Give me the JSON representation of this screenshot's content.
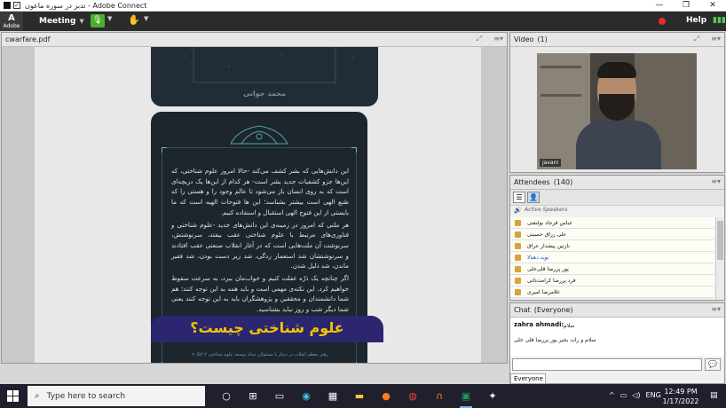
{
  "window": {
    "title": "تدبر در سوره ماعون - Adobe Connect",
    "controls": [
      "—",
      "❐",
      "✕"
    ]
  },
  "menubar": {
    "adobe_label": "Adobe",
    "meeting": "Meeting",
    "help": "Help"
  },
  "share": {
    "title": "cwarfare.pdf",
    "card_top_name": "محمد جواتی",
    "paragraphs": [
      "این دانش‌هایی که بشر کشف می‌کند -حالا امروز علوم شناختی، که این‌ها جزو کشفیات جدید بشر است- هر کدام از این‌ها یک دریچه‌ای است که به روی انسان باز می‌شود تا عالم وجود را و هستی را که صُنع الهی است بیشتر بشناسد؛ این ها فتوحات الهیه است که ما بایستی از این فتوح الهی استقبال و استفاده کنیم.",
      "هر ملتی که امروز در زمینه‌ی این دانش‌های جدید -علوم شناختی و فناوری‌های مرتبط با علوم شناختی عقب بیفتد، سرنوشتش، سرنوشت آن ملت‌هایی است که در آغاز انقلاب صنعتی عقب افتادند و سرنوشتشان شد استعمار زدگی، شد زیر دست بودن، شد فقیر ماندن، شد ذلیل شدن.",
      "اگر چنانچه یک ذرّه غفلت کنیم و خواب‌مان ببرد، به سرعت سقوط خواهیم کرد. این نکته‌ی مهمی است و باید همه به این توجه کنند؛ هم شما دانشمندان و محققین و پژوهشگران باید به این توجه کنند یعنی شما دیگر شب و روز نباید بشناسید."
    ],
    "footer": "رهبر معظم انقلاب در دیدار با مسئولان ستاد توسعه علوم شناختی ۹۰/۵/۱۲",
    "banner": "علوم شناختی چیست؟"
  },
  "video": {
    "title": "Video",
    "count": "(1)",
    "participant": "javani"
  },
  "attendees": {
    "title": "Attendees",
    "count": "(140)",
    "section": "Active Speakers",
    "rows": [
      {
        "name": "عباس فرجاد بولنفتی",
        "hl": false
      },
      {
        "name": "علی رزاق حسینی",
        "hl": false
      },
      {
        "name": "نازنین پیشدار عراق",
        "hl": false
      },
      {
        "name": "نوید دهبالا",
        "hl": true
      },
      {
        "name": "پور پررضا قلی‌خلی",
        "hl": false
      },
      {
        "name": "فرد پررضا کرامت‌ثانی",
        "hl": false
      },
      {
        "name": "غلامرضا امیری",
        "hl": false
      }
    ]
  },
  "chat": {
    "title": "Chat",
    "audience": "(Everyone)",
    "sender": "zahra ahmadi:",
    "msg1": "سلام",
    "msg2": "سلام و رات بخیر پور پررضا قلی خلی",
    "tab": "Everyone",
    "send_icon": "send-icon"
  },
  "taskbar": {
    "search_placeholder": "Type here to search",
    "language": "ENG",
    "time": "12:49 PM",
    "date": "1/17/2022"
  }
}
